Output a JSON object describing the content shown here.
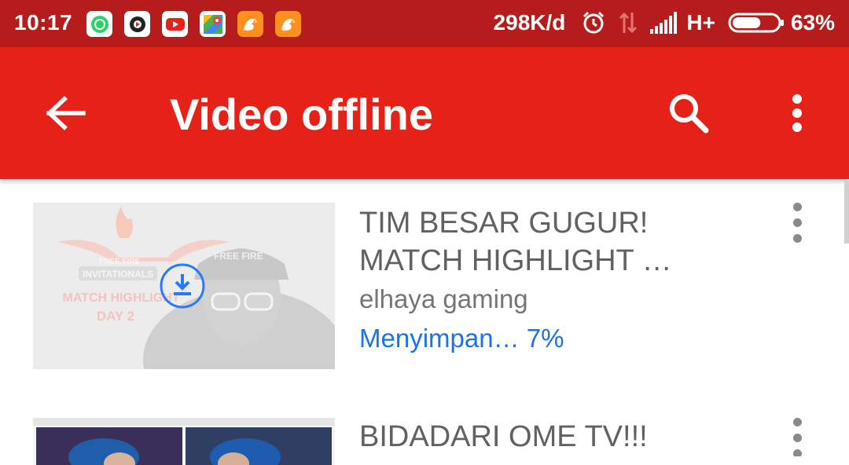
{
  "status_bar": {
    "time": "10:17",
    "speed": "298K/d",
    "network": "H+",
    "battery": "63%",
    "battery_level": 0.63,
    "notification_icons": [
      "whatsapp-icon",
      "browser-icon",
      "youtube-icon",
      "maps-icon",
      "uc-browser-icon",
      "uc-browser-icon"
    ]
  },
  "toolbar": {
    "title": "Video offline",
    "color": "#e62117"
  },
  "videos": [
    {
      "title": "TIM BESAR GUGUR! MATCH HIGHLIGHT …",
      "title_lines": [
        "TIM BESAR GUGUR!",
        "MATCH HIGHLIGHT …"
      ],
      "channel": "elhaya gaming",
      "status": "Menyimpan… 7%",
      "progress": 0.07,
      "thumb_text": {
        "brand": "FREE FIRE",
        "event": "INVITATIONALS",
        "subtitle": "MATCH HIGHLIGHT",
        "day": "DAY 2",
        "cap": "FREE FIRE"
      }
    },
    {
      "title": "BIDADARI OME TV!!!",
      "title_lines": [
        "BIDADARI OME TV!!!"
      ]
    }
  ],
  "colors": {
    "status_bar": "#b71c1c",
    "toolbar": "#e62117",
    "progress_text": "#1a73e8"
  }
}
